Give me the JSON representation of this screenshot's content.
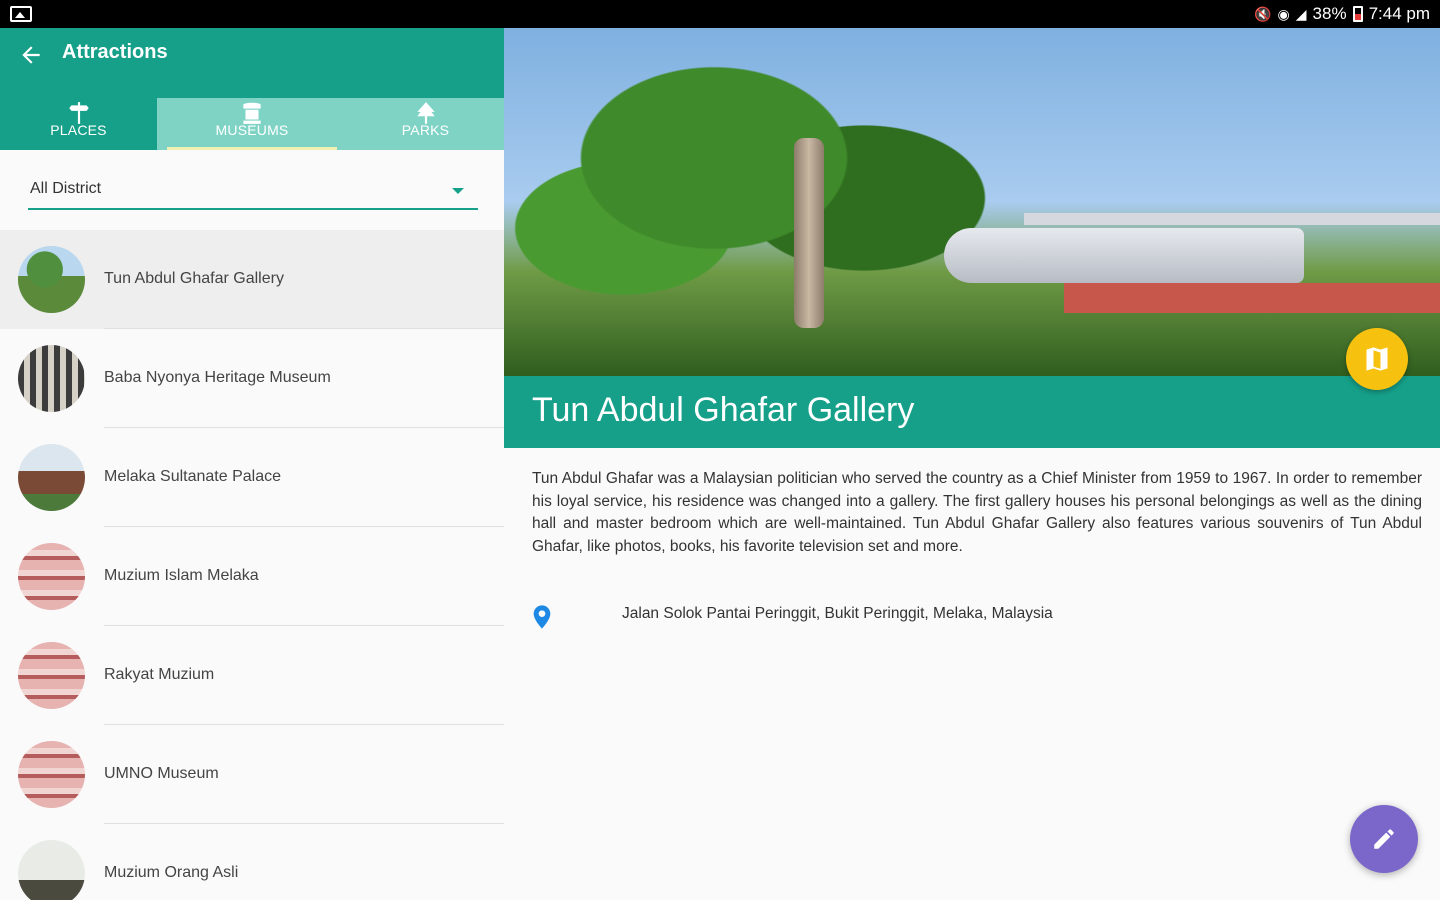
{
  "status_bar": {
    "battery": "38%",
    "time": "7:44 pm"
  },
  "app_bar": {
    "title": "Attractions"
  },
  "tabs": [
    {
      "label": "PLACES",
      "icon": "signpost-icon"
    },
    {
      "label": "MUSEUMS",
      "icon": "museum-icon"
    },
    {
      "label": "PARKS",
      "icon": "park-icon"
    }
  ],
  "filter": {
    "district": "All District"
  },
  "attractions": [
    {
      "name": "Tun Abdul Ghafar Gallery"
    },
    {
      "name": "Baba Nyonya Heritage Museum"
    },
    {
      "name": "Melaka Sultanate Palace"
    },
    {
      "name": "Muzium Islam Melaka"
    },
    {
      "name": "Rakyat Muzium"
    },
    {
      "name": "UMNO Museum"
    },
    {
      "name": "Muzium Orang Asli"
    }
  ],
  "detail": {
    "title": "Tun Abdul Ghafar Gallery",
    "description": "Tun Abdul Ghafar was a Malaysian politician who served the country as a Chief Minister from 1959 to 1967. In order to remember his loyal service, his residence was changed into a gallery. The first gallery houses his personal belongings as well as the dining hall and master bedroom which are well-maintained. Tun Abdul Ghafar Gallery also features various souvenirs of Tun Abdul Ghafar, like photos, books, his favorite television set and more.",
    "address": "Jalan Solok Pantai Peringgit, Bukit Peringgit, Melaka, Malaysia"
  },
  "colors": {
    "primary": "#16a08a",
    "tab_inactive": "#7fd3c5",
    "map_fab": "#f7c20f",
    "edit_fab": "#7a67c9",
    "location_pin": "#1e88e5"
  }
}
